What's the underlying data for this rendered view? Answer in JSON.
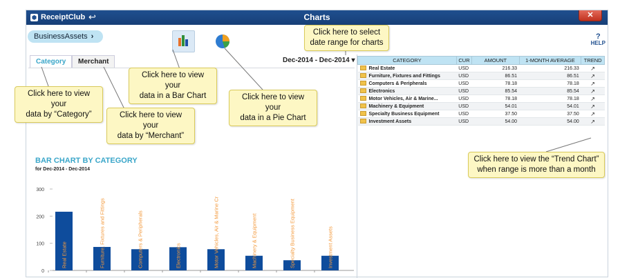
{
  "app": {
    "logo": "ReceiptClub",
    "title": "Charts",
    "close_icon": "close-icon",
    "back_icon": "back-arrow-icon"
  },
  "breadcrumb": {
    "label": "BusinessAssets",
    "chevron": "›"
  },
  "help": {
    "q": "?",
    "label": "HELP"
  },
  "tabs": [
    {
      "label": "Category",
      "active": true
    },
    {
      "label": "Merchant",
      "active": false
    }
  ],
  "date_range": {
    "label": "Dec-2014 - Dec-2014",
    "caret": "▾"
  },
  "grid": {
    "headers": [
      "CATEGORY",
      "CUR",
      "AMOUNT",
      "1-MONTH AVERAGE",
      "TREND"
    ],
    "rows": [
      [
        "Real Estate",
        "USD",
        "216.33",
        "216.33"
      ],
      [
        "Furniture, Fixtures and Fittings",
        "USD",
        "86.51",
        "86.51"
      ],
      [
        "Computers & Peripherals",
        "USD",
        "78.18",
        "78.18"
      ],
      [
        "Electronics",
        "USD",
        "85.54",
        "85.54"
      ],
      [
        "Motor Vehicles, Air & Marine...",
        "USD",
        "78.18",
        "78.18"
      ],
      [
        "Machinery & Equipment",
        "USD",
        "54.01",
        "54.01"
      ],
      [
        "Specialty Business Equipment",
        "USD",
        "37.50",
        "37.50"
      ],
      [
        "Investment Assets",
        "USD",
        "54.00",
        "54.00"
      ]
    ]
  },
  "chart": {
    "title": "BAR CHART BY CATEGORY",
    "subtitle": "for Dec-2014 - Dec-2014"
  },
  "chart_data": {
    "type": "bar",
    "title": "BAR CHART BY CATEGORY",
    "subtitle": "for Dec-2014 - Dec-2014",
    "categories": [
      "Real Estate",
      "Furniture, Fixtures and Fittings",
      "Computers & Peripherals",
      "Electronics",
      "Motor Vehicles, Air & Marine Cr",
      "Machinery & Equipment",
      "Specialty Business Equipment",
      "Investment Assets"
    ],
    "values": [
      216.33,
      86.51,
      78.18,
      85.54,
      78.18,
      54.01,
      37.5,
      54.0
    ],
    "ylim": [
      0,
      300
    ],
    "yticks": [
      "0",
      "100",
      "200",
      "300"
    ],
    "bar_color": "#0e4c9c",
    "label_color": "#f39a3d"
  },
  "callouts": {
    "date": [
      "Click here to select",
      "date range for charts"
    ],
    "bar": [
      "Click here to view your",
      "data in a Bar Chart"
    ],
    "pie": [
      "Click here to view your",
      "data in a Pie Chart"
    ],
    "category": [
      "Click here to view your",
      "data by “Category”"
    ],
    "merchant": [
      "Click here to view your",
      "data by “Merchant”"
    ],
    "trend": [
      "Click here to view the “Trend Chart”",
      "when range is more than a month"
    ]
  }
}
